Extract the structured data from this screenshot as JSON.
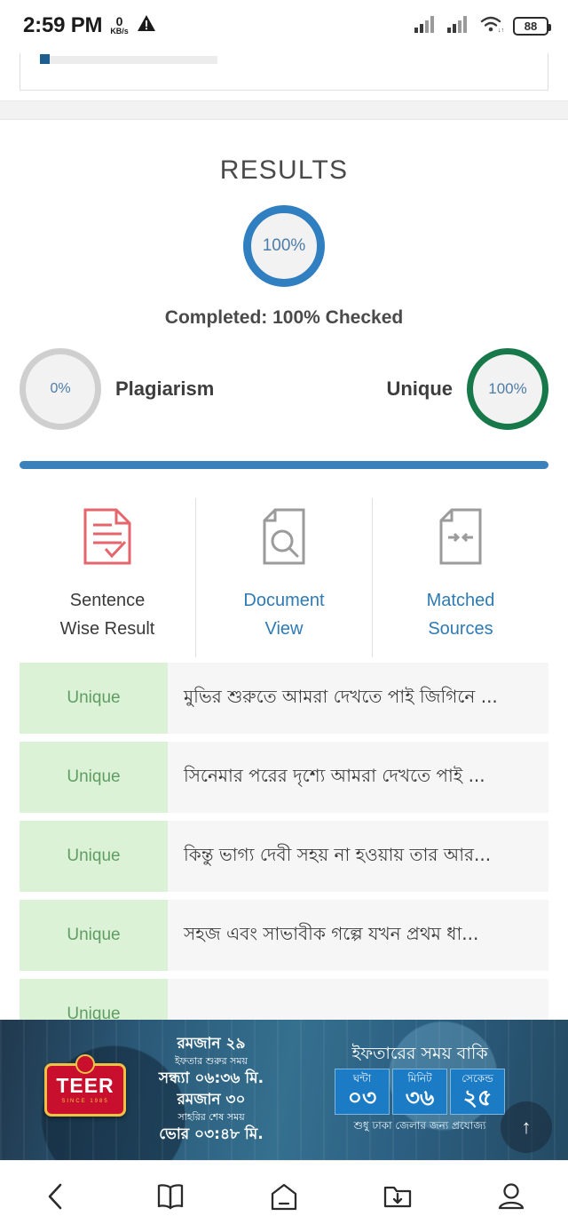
{
  "statusbar": {
    "time": "2:59 PM",
    "net_value": "0",
    "net_unit": "KB/s",
    "warning_icon": "warning-triangle-icon",
    "signal_icon": "signal-bars-icon",
    "signal2_icon": "signal-bars-icon",
    "wifi_icon": "wifi-icon",
    "battery_level": "88"
  },
  "top_card": {
    "placeholder_icon": "ad-placeholder-icon"
  },
  "results": {
    "title": "RESULTS",
    "overall_percent": "100%",
    "completed_text": "Completed: 100% Checked",
    "plagiarism": {
      "percent": "0%",
      "label": "Plagiarism"
    },
    "unique": {
      "percent": "100%",
      "label": "Unique"
    },
    "colors": {
      "overall_ring": "#2f7fc1",
      "plagiarism_ring": "#cfcfcf",
      "unique_ring": "#17784a",
      "divider": "#3b82bd",
      "link": "#2e7ab5",
      "badge_bg": "#dcf2d7",
      "badge_text": "#5f9d63"
    }
  },
  "tabs": [
    {
      "label": "Sentence\nWise Result",
      "line1": "Sentence",
      "line2": "Wise Result",
      "icon": "document-check-icon",
      "active": true
    },
    {
      "label": "Document View",
      "line1": "Document",
      "line2": "View",
      "icon": "document-search-icon",
      "active": false
    },
    {
      "label": "Matched Sources",
      "line1": "Matched",
      "line2": "Sources",
      "icon": "document-matched-icon",
      "active": false
    }
  ],
  "sentences": [
    {
      "status": "Unique",
      "text": "মুভির শুরুতে আমরা দেখতে পাই জিগিনে ..."
    },
    {
      "status": "Unique",
      "text": "সিনেমার পরের দৃশ্যে আমরা দেখতে পাই ..."
    },
    {
      "status": "Unique",
      "text": "কিন্তু ভাগ্য দেবী সহয় না হওয়ায় তার আর..."
    },
    {
      "status": "Unique",
      "text": "সহজ এবং সাভাবীক গল্পে যখন প্রথম ধা..."
    },
    {
      "status": "Unique",
      "text": ""
    }
  ],
  "ad": {
    "brand": "TEER",
    "brand_sub": "SINCE 1985",
    "ramadan_day_1": "রমজান ২৯",
    "iftar_label": "ইফতার শুরুর সময়",
    "iftar_time": "সন্ধ্যা ০৬:৩৬ মি.",
    "ramadan_day_2": "রমজান ৩০",
    "sehri_label": "সাহরির শেষ সময়",
    "sehri_time": "ভোর ০৩:৪৮ মি.",
    "countdown_title": "ইফতারের সময় বাকি",
    "countdown": [
      {
        "label": "ঘন্টা",
        "value": "০৩"
      },
      {
        "label": "মিনিট",
        "value": "৩৬"
      },
      {
        "label": "সেকেন্ড",
        "value": "২৫"
      }
    ],
    "note": "শুধু ঢাকা জেলার জন্য প্রযোজ্য"
  },
  "scroll_top": {
    "icon": "arrow-up-icon",
    "glyph": "↑"
  },
  "navbar": [
    {
      "name": "back-icon"
    },
    {
      "name": "bookmarks-icon"
    },
    {
      "name": "home-icon"
    },
    {
      "name": "downloads-icon"
    },
    {
      "name": "profile-icon"
    }
  ]
}
